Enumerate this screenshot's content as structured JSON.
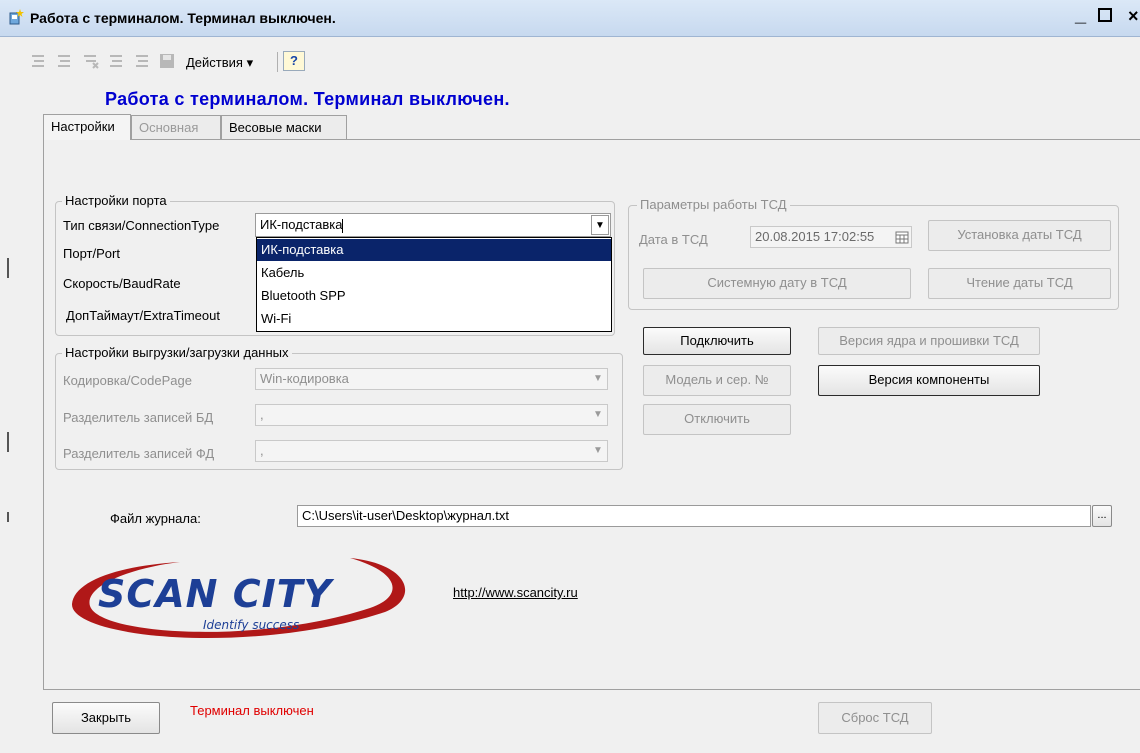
{
  "window": {
    "title": "Работа с терминалом. Терминал выключен.",
    "min": "_",
    "close": "×"
  },
  "toolbar": {
    "actions_label": "Действия ▾",
    "help_label": "?"
  },
  "header": "Работа с терминалом. Терминал выключен.",
  "tabs": [
    "Настройки",
    "Основная",
    "Весовые маски"
  ],
  "port_settings": {
    "title": "Настройки порта",
    "connection_type_label": "Тип связи/ConnectionType",
    "connection_type_value": "ИК-подставка",
    "port_label": "Порт/Port",
    "baud_label": "Скорость/BaudRate",
    "timeout_label": "ДопТаймаут/ExtraTimeout",
    "options": [
      "ИК-подставка",
      "Кабель",
      "Bluetooth SPP",
      "Wi-Fi"
    ]
  },
  "export_settings": {
    "title": "Настройки выгрузки/загрузки данных",
    "codepage_label": "Кодировка/CodePage",
    "codepage_value": "Win-кодировка",
    "db_sep_label": "Разделитель записей БД",
    "db_sep_value": ",",
    "fd_sep_label": "Разделитель записей ФД",
    "fd_sep_value": ","
  },
  "tsd_params": {
    "title": "Параметры работы ТСД",
    "date_label": "Дата в ТСД",
    "date_value": "20.08.2015 17:02:55",
    "set_date_button": "Установка даты ТСД",
    "system_date_button": "Системную дату в ТСД",
    "read_date_button": "Чтение даты ТСД"
  },
  "buttons": {
    "connect": "Подключить",
    "firmware": "Версия ядра и прошивки ТСД",
    "model": "Модель и сер. №",
    "component": "Версия компоненты",
    "disconnect": "Отключить",
    "close": "Закрыть",
    "reset": "Сброс ТСД",
    "browse": "..."
  },
  "log": {
    "label": "Файл журнала:",
    "path": "C:\\Users\\it-user\\Desktop\\журнал.txt"
  },
  "logo": {
    "name": "SCAN CITY",
    "slogan": "Identify success"
  },
  "link": "http://www.scancity.ru",
  "status": "Терминал выключен",
  "colors": {
    "header_blue": "#0000d0",
    "status_red": "#e00000",
    "selection": "#0a246a",
    "logo_blue": "#1d3f96",
    "logo_red": "#b01818"
  }
}
